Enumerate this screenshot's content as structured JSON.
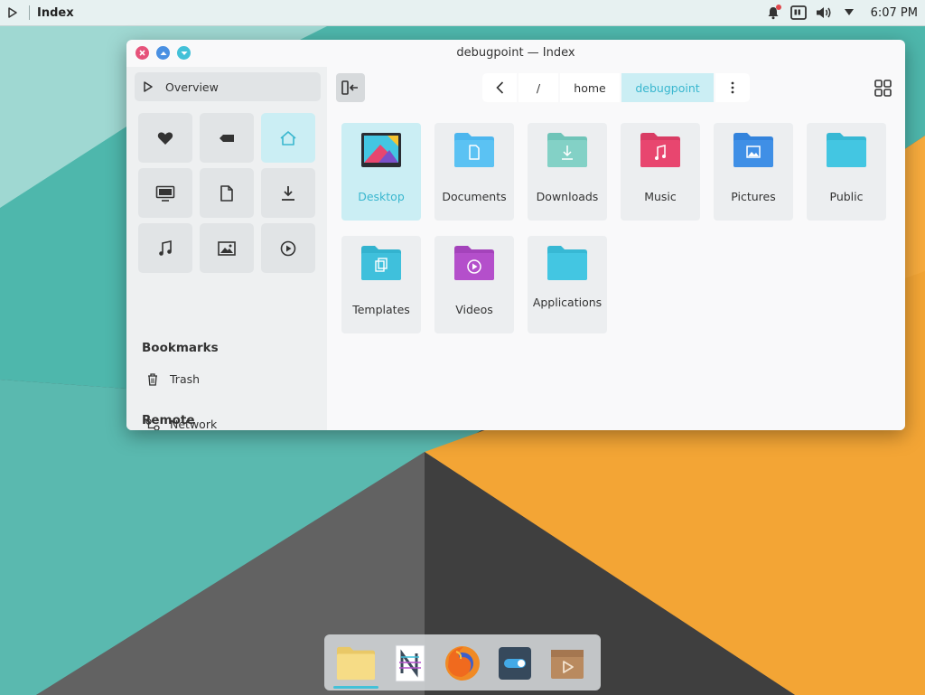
{
  "top_panel": {
    "app_title": "Index",
    "clock": "6:07 PM",
    "tray_icons": [
      "notification-bell-icon",
      "tray-app-icon",
      "volume-icon",
      "menu-arrow-icon"
    ]
  },
  "window": {
    "title": "debugpoint — Index",
    "buttons": [
      "close",
      "minimize",
      "maximize"
    ]
  },
  "sidebar": {
    "overview_label": "Overview",
    "quick_access": [
      "favorites-icon",
      "tags-icon",
      "home-icon",
      "desktop-icon",
      "documents-icon",
      "downloads-icon",
      "music-icon",
      "pictures-icon",
      "videos-icon"
    ],
    "active_quick_access": "home-icon",
    "bookmarks_heading": "Bookmarks",
    "bookmarks": [
      {
        "label": "Trash",
        "icon": "trash-icon"
      }
    ],
    "remote_heading": "Remote",
    "remote": [
      {
        "label": "Network",
        "icon": "network-icon"
      }
    ]
  },
  "toolbar": {
    "breadcrumb": {
      "back": "<",
      "root": "/",
      "home": "home",
      "current": "debugpoint"
    }
  },
  "files": [
    {
      "label": "Desktop",
      "icon": "desktop-icon",
      "selected": true
    },
    {
      "label": "Documents",
      "icon": "folder-documents-icon",
      "color": "#4cb6ee"
    },
    {
      "label": "Downloads",
      "icon": "folder-downloads-icon",
      "color": "#7fcfc4"
    },
    {
      "label": "Music",
      "icon": "folder-music-icon",
      "color": "#e8466f"
    },
    {
      "label": "Pictures",
      "icon": "folder-pictures-icon",
      "color": "#3f8fe6"
    },
    {
      "label": "Public",
      "icon": "folder-public-icon",
      "color": "#43c6e2"
    },
    {
      "label": "Templates",
      "icon": "folder-templates-icon",
      "color": "#3fc0dc"
    },
    {
      "label": "Videos",
      "icon": "folder-videos-icon",
      "color": "#b44fcb"
    },
    {
      "label": "Applications",
      "icon": "folder-applications-icon",
      "color": "#43c6e2"
    }
  ],
  "dock": {
    "items": [
      "file-manager-icon",
      "notes-app-icon",
      "firefox-icon",
      "settings-toggle-icon",
      "package-store-icon"
    ],
    "active": "file-manager-icon"
  },
  "colors": {
    "accent": "#43c1d8",
    "wallpaper_teal": "#4fb8ad",
    "wallpaper_orange": "#f5a93a",
    "wallpaper_grey": "#555555"
  }
}
